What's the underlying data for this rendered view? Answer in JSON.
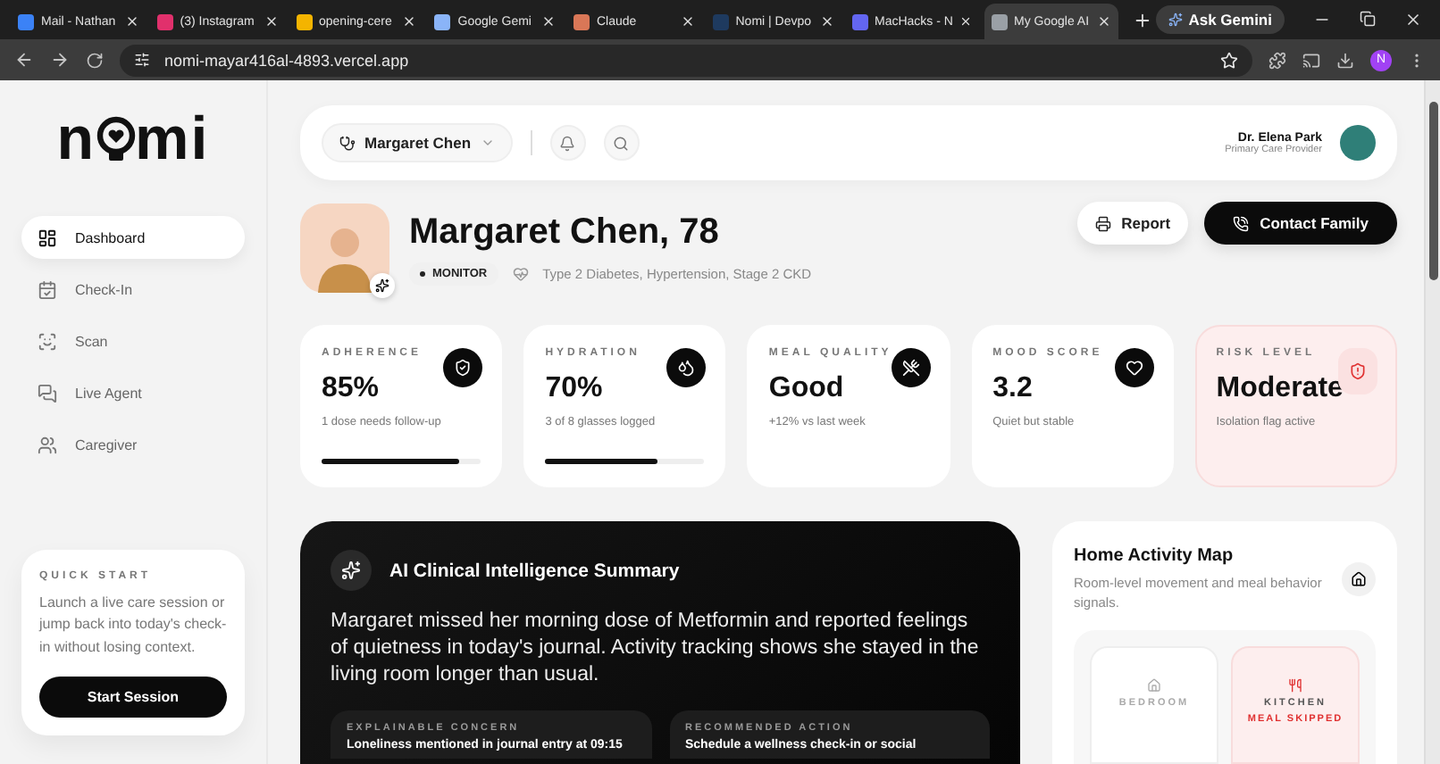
{
  "browser": {
    "tabs": [
      {
        "title": "Mail - Nathan",
        "selected": false,
        "color": "#3b82f6"
      },
      {
        "title": "(3) Instagram",
        "selected": false,
        "color": "#e1306c"
      },
      {
        "title": "opening-cere",
        "selected": false,
        "color": "#f4b400"
      },
      {
        "title": "Google Gemi",
        "selected": false,
        "color": "#8ab4f8"
      },
      {
        "title": "Claude",
        "selected": false,
        "color": "#d97757"
      },
      {
        "title": "Nomi | Devpo",
        "selected": false,
        "color": "#1e3a5f"
      },
      {
        "title": "MacHacks - N",
        "selected": false,
        "color": "#6366f1"
      },
      {
        "title": "My Google AI",
        "selected": true,
        "color": "#9aa0a6"
      }
    ],
    "ask_button": "Ask Gemini",
    "url": "nomi-mayar416al-4893.vercel.app",
    "profile": "N"
  },
  "sidebar": {
    "logo_start": "n",
    "logo_end": "mi",
    "items": [
      {
        "label": "Dashboard",
        "selected": true
      },
      {
        "label": "Check-In",
        "selected": false
      },
      {
        "label": "Scan",
        "selected": false
      },
      {
        "label": "Live Agent",
        "selected": false
      },
      {
        "label": "Caregiver",
        "selected": false
      }
    ],
    "quick_start": {
      "heading": "QUICK START",
      "text": "Launch a live care session or jump back into today's check-in without losing context.",
      "button": "Start Session"
    }
  },
  "header": {
    "patient": "Margaret Chen",
    "doctor": "Dr. Elena Park",
    "role": "Primary Care Provider"
  },
  "patient": {
    "name": "Margaret Chen, 78",
    "status": "MONITOR",
    "conditions": "Type 2 Diabetes, Hypertension, Stage 2 CKD",
    "buttons": [
      "Report",
      "Contact Family"
    ]
  },
  "stats": [
    {
      "kind": "normal",
      "label": "ADHERENCE",
      "value": "85%",
      "note": "1 dose needs follow-up",
      "level": 0.86
    },
    {
      "kind": "normal",
      "label": "HYDRATION",
      "value": "70%",
      "note": "3 of 8 glasses logged",
      "level": 0.7
    },
    {
      "kind": "normal",
      "label": "MEAL QUALITY",
      "value": "Good",
      "note": "+12% vs last week"
    },
    {
      "kind": "normal",
      "label": "MOOD SCORE",
      "value": "3.2",
      "note": "Quiet but stable"
    },
    {
      "kind": "alert",
      "label": "RISK LEVEL",
      "value": "Moderate",
      "note": "Isolation flag active"
    }
  ],
  "summary": {
    "title": "AI Clinical Intelligence Summary",
    "text": "Margaret missed her morning dose of Metformin and reported feelings of quietness in today's journal. Activity tracking shows she stayed in the living room longer than usual.",
    "boxes": [
      {
        "label": "EXPLAINABLE CONCERN",
        "text": "Loneliness mentioned in journal entry at 09:15"
      },
      {
        "label": "RECOMMENDED ACTION",
        "text": "Schedule a wellness check-in or social"
      }
    ]
  },
  "map": {
    "title": "Home Activity Map",
    "subtitle": "Room-level movement and meal behavior signals.",
    "rooms": [
      {
        "label": "BEDROOM",
        "alert": false
      },
      {
        "label": "KITCHEN",
        "note": "MEAL SKIPPED",
        "alert": true
      }
    ]
  }
}
